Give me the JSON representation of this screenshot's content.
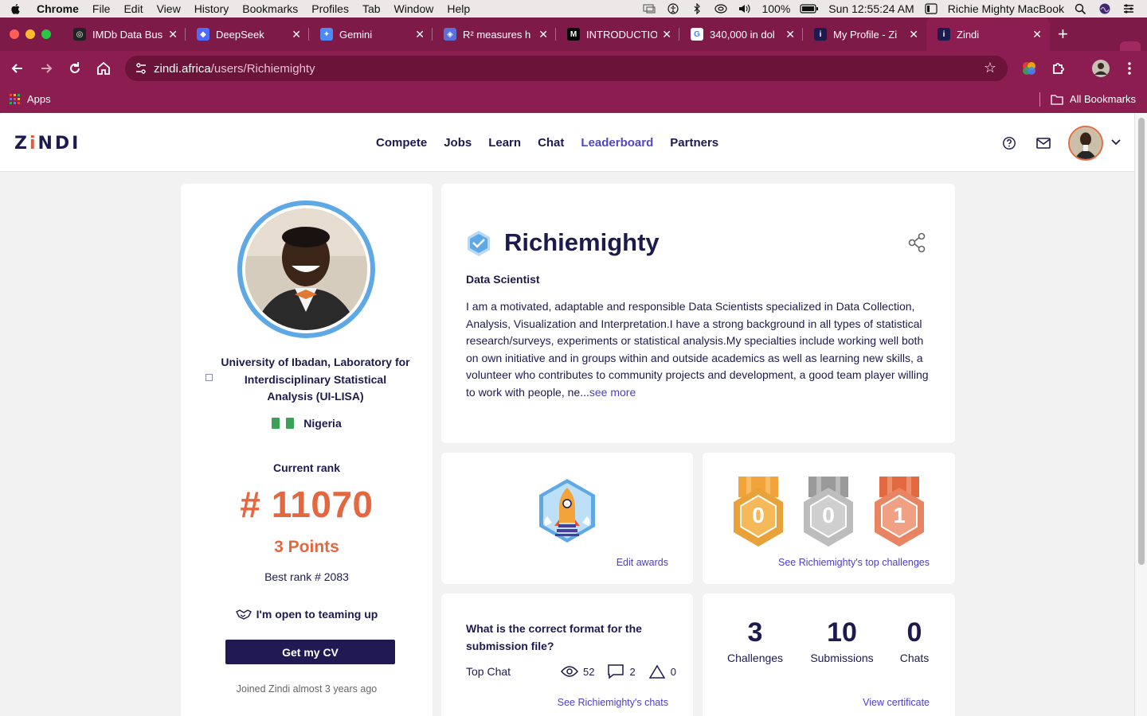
{
  "menubar": {
    "app": "Chrome",
    "items": [
      "File",
      "Edit",
      "View",
      "History",
      "Bookmarks",
      "Profiles",
      "Tab",
      "Window",
      "Help"
    ],
    "battery": "100%",
    "clock": "Sun 12:55:24 AM",
    "machine": "Richie Mighty MacBook"
  },
  "tabs": [
    {
      "title": "IMDb Data Bus",
      "fav_color": "#222222",
      "fav_glyph": "◎"
    },
    {
      "title": "DeepSeek",
      "fav_color": "#4d6bfe",
      "fav_glyph": "◆"
    },
    {
      "title": "Gemini",
      "fav_color": "#4b8bf5",
      "fav_glyph": "✦"
    },
    {
      "title": "R² measures h",
      "fav_color": "#5a6fd8",
      "fav_glyph": "◈"
    },
    {
      "title": "INTRODUCTIO",
      "fav_color": "#000000",
      "fav_glyph": "M"
    },
    {
      "title": "340,000 in dol",
      "fav_color": "#ffffff",
      "fav_glyph": "G"
    },
    {
      "title": "My Profile - Zi",
      "fav_color": "#1d1a4e",
      "fav_glyph": "i"
    },
    {
      "title": "Zindi",
      "fav_color": "#1d1a4e",
      "fav_glyph": "i"
    }
  ],
  "omnibox": {
    "domain": "zindi.africa",
    "path": "/users/Richiemighty"
  },
  "bookmarks": {
    "apps": "Apps",
    "all": "All Bookmarks"
  },
  "site": {
    "logo_pre": "Z",
    "logo_i": "i",
    "logo_post": "NDI",
    "nav": [
      {
        "label": "Compete",
        "active": false
      },
      {
        "label": "Jobs",
        "active": false
      },
      {
        "label": "Learn",
        "active": false
      },
      {
        "label": "Chat",
        "active": false
      },
      {
        "label": "Leaderboard",
        "active": true
      },
      {
        "label": "Partners",
        "active": false
      }
    ]
  },
  "profile": {
    "university": "University of Ibadan, Laboratory for Interdisciplinary Statistical Analysis (UI-LISA)",
    "country": "Nigeria",
    "current_rank_label": "Current rank",
    "rank": "# 11070",
    "points": "3 Points",
    "best_rank": "Best rank # 2083",
    "teaming": "I'm open to teaming up",
    "cv_button": "Get my CV",
    "joined": "Joined Zindi almost 3 years ago",
    "username": "Richiemighty",
    "title": "Data Scientist",
    "bio": "I am a motivated, adaptable and responsible Data Scientists specialized in Data Collection, Analysis, Visualization and Interpretation.I have a strong background in all types of statistical research/surveys, experiments or statistical analysis.My specialties include working well both on own initiative and in groups within and outside academics as well as learning new skills, a volunteer who contributes to community projects and development, a good team player willing to work with people, ne...",
    "see_more": "see more"
  },
  "awards": {
    "edit_label": "Edit awards"
  },
  "medals": {
    "gold": "0",
    "silver": "0",
    "bronze": "1",
    "link": "See Richiemighty's top challenges"
  },
  "chat": {
    "question": "What is the correct format for the submission file?",
    "label": "Top Chat",
    "views": "52",
    "comments": "2",
    "votes": "0",
    "link": "See Richiemighty's chats"
  },
  "stats": {
    "challenges": {
      "value": "3",
      "label": "Challenges"
    },
    "submissions": {
      "value": "10",
      "label": "Submissions"
    },
    "chats": {
      "value": "0",
      "label": "Chats"
    },
    "link": "View certificate"
  }
}
